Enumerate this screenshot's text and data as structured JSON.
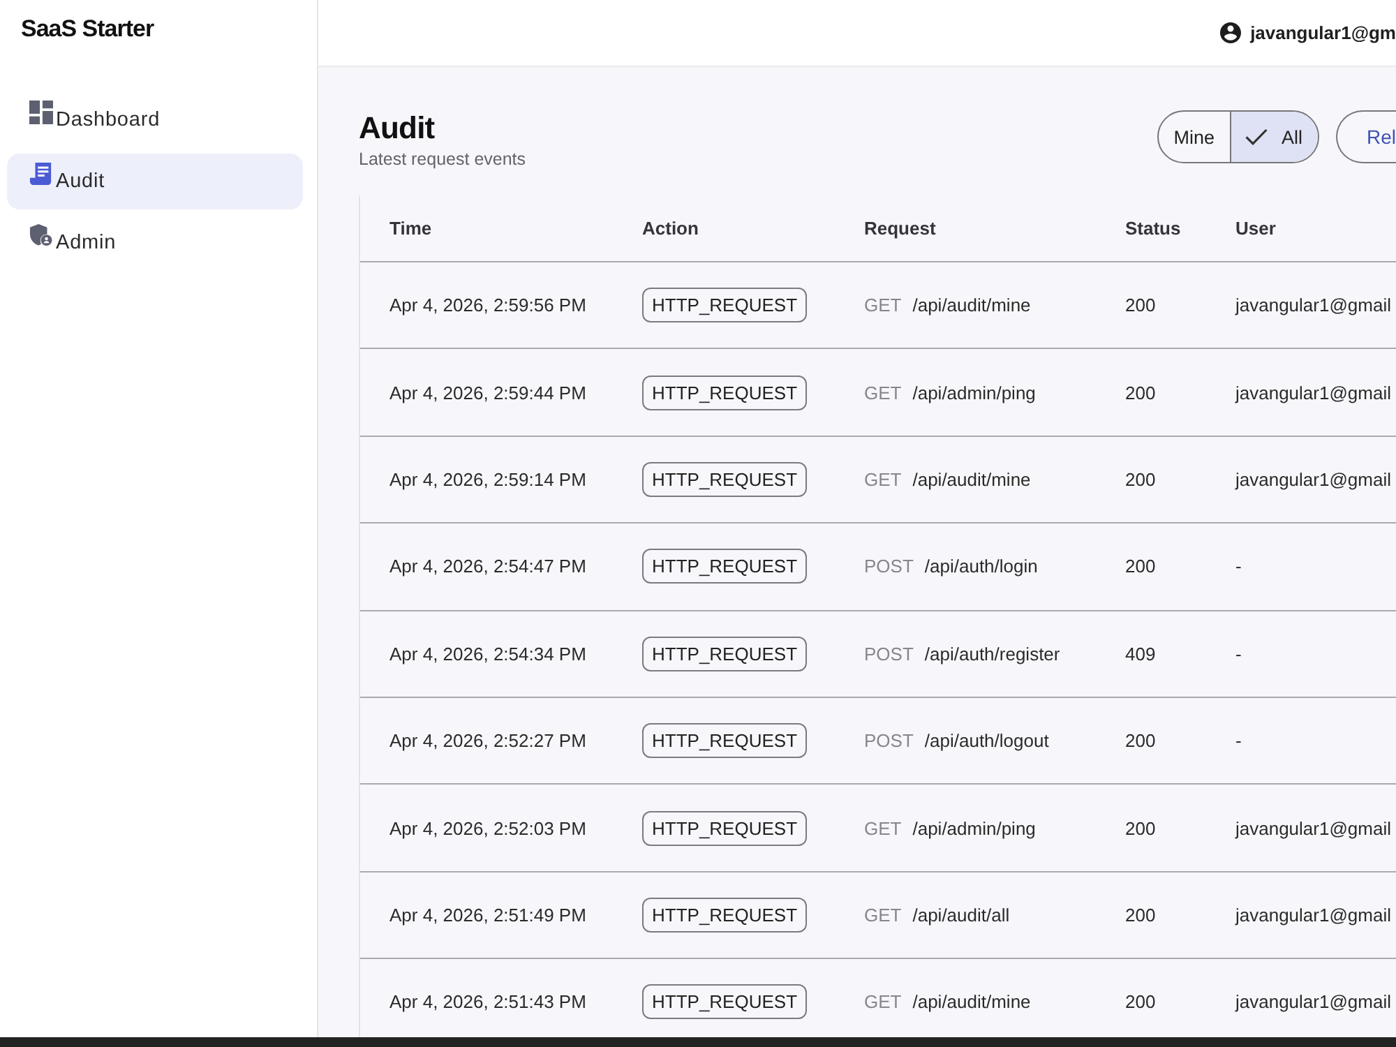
{
  "sidebar": {
    "brand": "SaaS Starter",
    "items": [
      {
        "label": "Dashboard",
        "selected": false
      },
      {
        "label": "Audit",
        "selected": true
      },
      {
        "label": "Admin",
        "selected": false
      }
    ]
  },
  "top_bar": {
    "user": "javangular1@gm"
  },
  "page": {
    "title": "Audit",
    "subtitle": "Latest request events",
    "filter": [
      {
        "label": "Mine",
        "selected": false
      },
      {
        "label": "All",
        "selected": true
      }
    ],
    "reload_button": "Rel"
  },
  "table": {
    "columns": [
      "Time",
      "Action",
      "Request",
      "Status",
      "User"
    ],
    "rows": [
      {
        "time": "Apr 4, 2026, 2:59:56 PM",
        "action": "HTTP_REQUEST",
        "method": "GET",
        "path": "/api/audit/mine",
        "status": "200",
        "user": "javangular1@gmail"
      },
      {
        "time": "Apr 4, 2026, 2:59:44 PM",
        "action": "HTTP_REQUEST",
        "method": "GET",
        "path": "/api/admin/ping",
        "status": "200",
        "user": "javangular1@gmail"
      },
      {
        "time": "Apr 4, 2026, 2:59:14 PM",
        "action": "HTTP_REQUEST",
        "method": "GET",
        "path": "/api/audit/mine",
        "status": "200",
        "user": "javangular1@gmail"
      },
      {
        "time": "Apr 4, 2026, 2:54:47 PM",
        "action": "HTTP_REQUEST",
        "method": "POST",
        "path": "/api/auth/login",
        "status": "200",
        "user": "-"
      },
      {
        "time": "Apr 4, 2026, 2:54:34 PM",
        "action": "HTTP_REQUEST",
        "method": "POST",
        "path": "/api/auth/register",
        "status": "409",
        "user": "-"
      },
      {
        "time": "Apr 4, 2026, 2:52:27 PM",
        "action": "HTTP_REQUEST",
        "method": "POST",
        "path": "/api/auth/logout",
        "status": "200",
        "user": "-"
      },
      {
        "time": "Apr 4, 2026, 2:52:03 PM",
        "action": "HTTP_REQUEST",
        "method": "GET",
        "path": "/api/admin/ping",
        "status": "200",
        "user": "javangular1@gmail"
      },
      {
        "time": "Apr 4, 2026, 2:51:49 PM",
        "action": "HTTP_REQUEST",
        "method": "GET",
        "path": "/api/audit/all",
        "status": "200",
        "user": "javangular1@gmail"
      },
      {
        "time": "Apr 4, 2026, 2:51:43 PM",
        "action": "HTTP_REQUEST",
        "method": "GET",
        "path": "/api/audit/mine",
        "status": "200",
        "user": "javangular1@gmail"
      }
    ]
  }
}
